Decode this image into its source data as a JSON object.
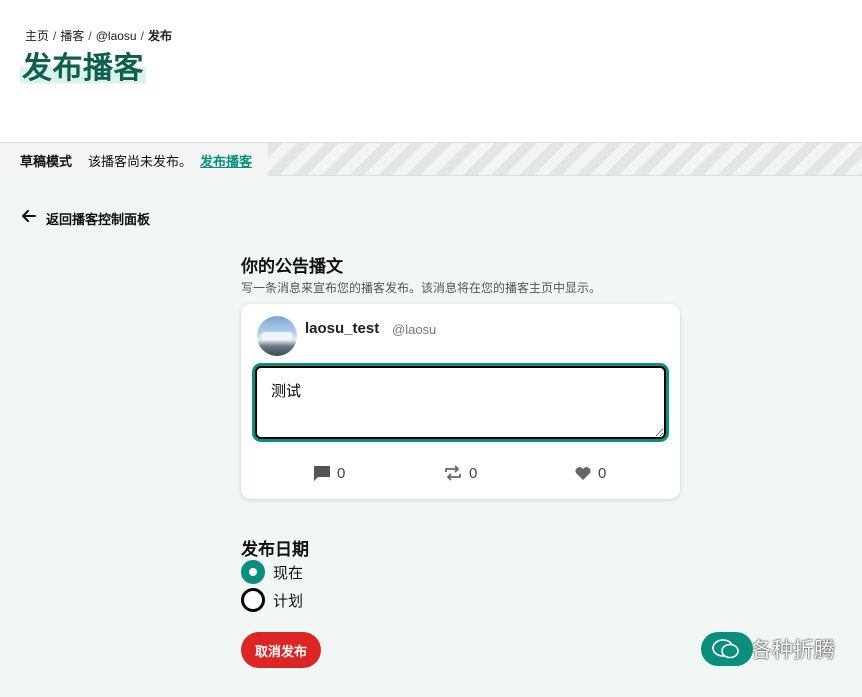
{
  "breadcrumb": {
    "items": [
      "主页",
      "播客",
      "@laosu",
      "发布"
    ],
    "separator": "/"
  },
  "page": {
    "title": "发布播客"
  },
  "draft_bar": {
    "label": "草稿模式",
    "message": "该播客尚未发布。",
    "link": "发布播客"
  },
  "nav": {
    "back_label": "返回播客控制面板"
  },
  "announcement": {
    "title": "你的公告播文",
    "description": "写一条消息来宣布您的播客发布。该消息将在您的播客主页中显示。",
    "user_name": "laosu_test",
    "user_handle": "@laosu",
    "post_text": "测试",
    "stats": {
      "replies": "0",
      "reblogs": "0",
      "likes": "0"
    }
  },
  "publish_date": {
    "title": "发布日期",
    "options": [
      {
        "label": "现在",
        "checked": true
      },
      {
        "label": "计划",
        "checked": false
      }
    ]
  },
  "actions": {
    "cancel_label": "取消发布"
  },
  "watermark": {
    "text": "各种折腾"
  },
  "colors": {
    "accent": "#0a8f7d",
    "title": "#0f5e4f",
    "danger": "#dc2626",
    "background": "#f0f7f5"
  }
}
